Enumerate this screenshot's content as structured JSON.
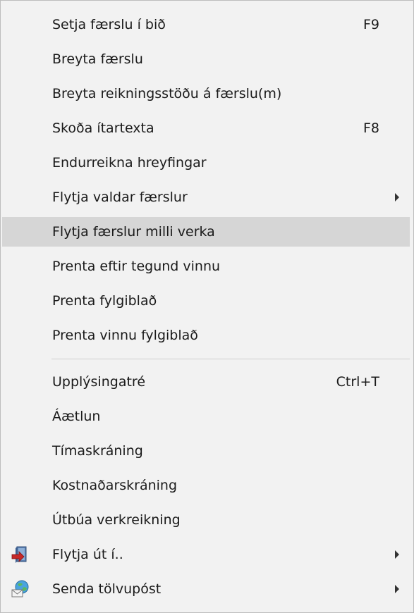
{
  "menu": {
    "items": [
      {
        "label": "Setja færslu í bið",
        "shortcut": "F9"
      },
      {
        "label": "Breyta færslu"
      },
      {
        "label": "Breyta reikningsstöðu á færslu(m)"
      },
      {
        "label": "Skoða ítartexta",
        "shortcut": "F8"
      },
      {
        "label": "Endurreikna hreyfingar"
      },
      {
        "label": "Flytja valdar færslur",
        "submenu": true
      },
      {
        "label": "Flytja færslur milli verka",
        "highlighted": true
      },
      {
        "label": "Prenta eftir tegund vinnu"
      },
      {
        "label": "Prenta fylgiblað"
      },
      {
        "label": "Prenta vinnu fylgiblað"
      },
      {
        "label": "Upplýsingatré",
        "shortcut": "Ctrl+T"
      },
      {
        "label": "Áætlun"
      },
      {
        "label": "Tímaskráning"
      },
      {
        "label": "Kostnaðarskráning"
      },
      {
        "label": "Útbúa verkreikning"
      },
      {
        "label": "Flytja út í..",
        "submenu": true,
        "icon": "export-book-icon"
      },
      {
        "label": "Senda tölvupóst",
        "submenu": true,
        "icon": "send-email-globe-icon"
      }
    ]
  },
  "colors": {
    "highlight": "#d6d6d6",
    "background": "#f2f2f2"
  }
}
